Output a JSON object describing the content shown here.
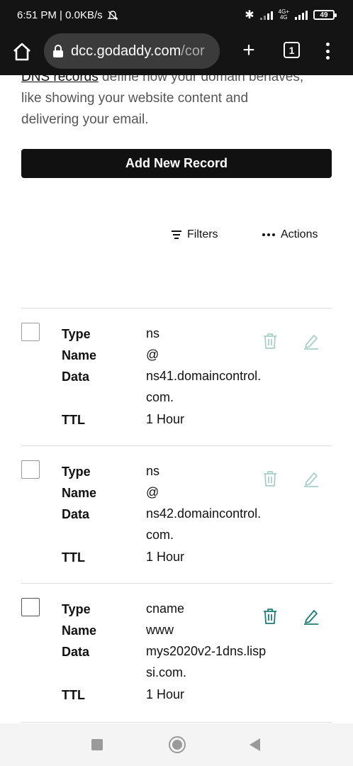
{
  "status_bar": {
    "time_speed": "6:51 PM | 0.0KB/s",
    "network_label_top": "4G+",
    "network_label_bottom": "4G",
    "battery": "49"
  },
  "browser": {
    "url_domain": "dcc.godaddy.com",
    "url_path": "/cor",
    "tab_count": "1"
  },
  "page": {
    "intro_link": "DNS records",
    "intro_text_1": " define how your domain behaves,",
    "intro_text_2": "like showing your website content and",
    "intro_text_3": "delivering your email.",
    "add_button_label": "Add New Record",
    "filters_label": "Filters",
    "actions_label": "Actions"
  },
  "labels": {
    "type": "Type",
    "name": "Name",
    "data": "Data",
    "ttl": "TTL"
  },
  "records": [
    {
      "type": "ns",
      "name": "@",
      "data": "ns41.domaincontrol.com.",
      "ttl": "1 Hour",
      "editable": false
    },
    {
      "type": "ns",
      "name": "@",
      "data": "ns42.domaincontrol.com.",
      "ttl": "1 Hour",
      "editable": false
    },
    {
      "type": "cname",
      "name": "www",
      "data": "mys2020v2-1dns.lispsi.com.",
      "ttl": "1 Hour",
      "editable": true
    }
  ],
  "colors": {
    "accent_teal": "#1b7e76",
    "disabled_teal": "#a8cfcb",
    "bar_dark": "#141414",
    "url_box": "#3b3b3b"
  }
}
